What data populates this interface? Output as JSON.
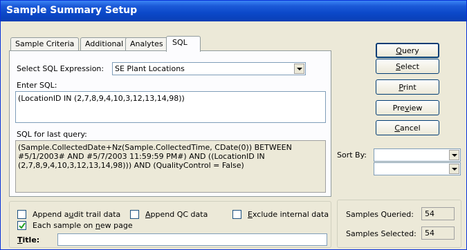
{
  "window": {
    "title": "Sample Summary Setup"
  },
  "tabs": [
    {
      "label": "Sample Criteria"
    },
    {
      "label": "Additional"
    },
    {
      "label": "Analytes"
    },
    {
      "label": "SQL"
    }
  ],
  "sql_tab": {
    "select_label": "Select SQL Expression:",
    "select_value": "SE Plant Locations",
    "enter_label": "Enter SQL:",
    "enter_value": "(LocationID IN (2,7,8,9,4,10,3,12,13,14,98))",
    "last_label": "SQL for last query:",
    "last_value": "(Sample.CollectedDate+Nz(Sample.CollectedTime, CDate(0)) BETWEEN\n#5/1/2003# AND #5/7/2003 11:59:59 PM#) AND ((LocationID IN\n(2,7,8,9,4,10,3,12,13,14,98))) AND (QualityControl = False)"
  },
  "buttons": {
    "query": {
      "pre": "",
      "ul": "Q",
      "post": "uery"
    },
    "select": {
      "pre": "",
      "ul": "S",
      "post": "elect"
    },
    "print": {
      "pre": "",
      "ul": "P",
      "post": "rint"
    },
    "preview": {
      "pre": "Pre",
      "ul": "v",
      "post": "iew"
    },
    "cancel": {
      "pre": "",
      "ul": "C",
      "post": "ancel"
    }
  },
  "sort": {
    "label": "Sort By:",
    "value1": "",
    "value2": ""
  },
  "options": {
    "audit": {
      "pre": "Append a",
      "ul": "u",
      "post": "dit trail data",
      "checked": false
    },
    "qc": {
      "pre": "",
      "ul": "A",
      "post": "ppend QC data",
      "checked": false
    },
    "internal": {
      "pre": "",
      "ul": "E",
      "post": "xclude internal data",
      "checked": false
    },
    "each_sample": {
      "pre": "Each sample on ",
      "ul": "n",
      "post": "ew page",
      "checked": true
    }
  },
  "title_field": {
    "pre": "",
    "ul": "T",
    "post": "itle:",
    "value": ""
  },
  "counts": {
    "queried_label": "Samples Queried:",
    "queried_value": "54",
    "selected_label": "Samples Selected:",
    "selected_value": "54"
  }
}
